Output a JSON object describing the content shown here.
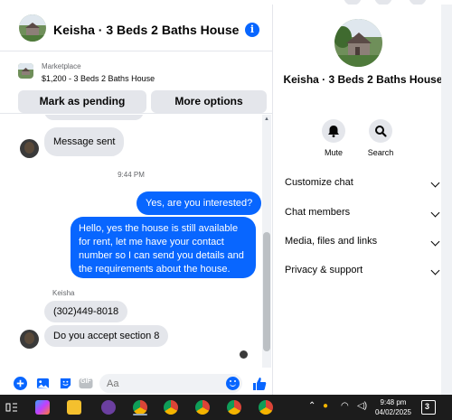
{
  "chat": {
    "title": "Keisha · 3 Beds 2 Baths House",
    "info_icon": "info-icon",
    "marketplace": {
      "label": "Marketplace",
      "listing": "$1,200 - 3 Beds 2 Baths House",
      "mark_pending_label": "Mark as pending",
      "more_options_label": "More options"
    },
    "messages": [
      {
        "from": "them",
        "text": "Message sent"
      },
      {
        "type": "timestamp",
        "text": "9:44 PM"
      },
      {
        "from": "me",
        "text": "Yes, are you interested?"
      },
      {
        "from": "me",
        "text": "Hello, yes the house is still available for rent, let me have your contact number so I can send you details and the requirements about the house."
      },
      {
        "type": "sender",
        "text": "Keisha"
      },
      {
        "from": "them",
        "text": "(302)449-8018"
      },
      {
        "from": "them",
        "text": "Do you accept section 8"
      }
    ],
    "composer": {
      "placeholder": "Aa",
      "icons": [
        "plus-circle-icon",
        "photo-icon",
        "sticker-icon",
        "gif-icon",
        "emoji-icon",
        "thumbs-up-icon"
      ],
      "gif_label": "GIF"
    }
  },
  "details": {
    "name": "Keisha · 3 Beds 2 Baths House",
    "actions": [
      {
        "icon": "bell-icon",
        "label": "Mute"
      },
      {
        "icon": "search-icon",
        "label": "Search"
      }
    ],
    "menu": [
      {
        "label": "Customize chat"
      },
      {
        "label": "Chat members"
      },
      {
        "label": "Media, files and links"
      },
      {
        "label": "Privacy & support"
      }
    ]
  },
  "taskbar": {
    "time": "9:48 pm",
    "date": "04/02/2025",
    "notification_count": "3",
    "colors": {
      "accent": "#0866ff",
      "bubble_in": "#e4e6eb"
    }
  }
}
